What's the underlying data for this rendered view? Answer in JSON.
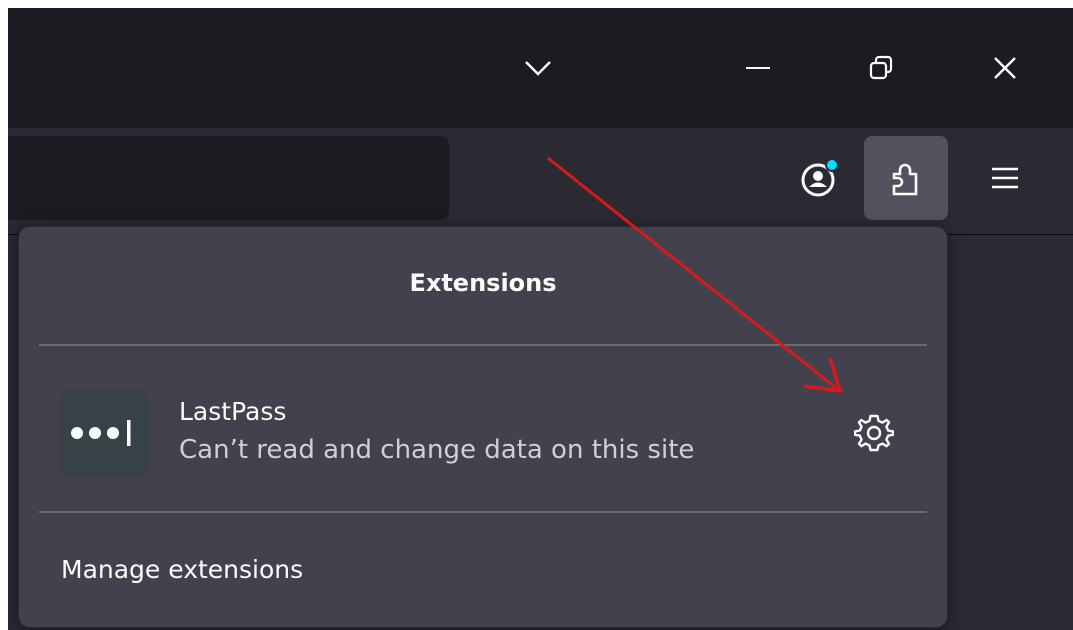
{
  "window_controls": {
    "tabs_menu_icon": "chevron-down-icon",
    "minimize_icon": "minimize-icon",
    "restore_icon": "restore-icon",
    "close_icon": "close-icon"
  },
  "toolbar": {
    "account_icon": "account-icon",
    "extensions_icon": "puzzle-piece-icon",
    "menu_icon": "hamburger-menu-icon",
    "account_badge_color": "#0df"
  },
  "extensions_panel": {
    "title": "Extensions",
    "items": [
      {
        "name": "LastPass",
        "description": "Can’t read and change data on this site",
        "icon": "lastpass-icon",
        "settings_icon": "gear-icon"
      }
    ],
    "manage_label": "Manage extensions"
  },
  "colors": {
    "titlebar": "#1c1b22",
    "toolbar": "#2b2a33",
    "panel": "#42414d",
    "annotation_arrow": "#d61a1a"
  }
}
